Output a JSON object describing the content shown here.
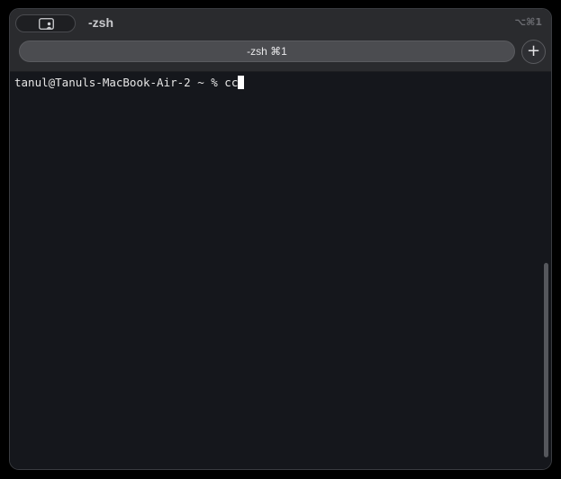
{
  "window": {
    "title": "-zsh",
    "shortcut_hint": "⌥⌘1"
  },
  "tabs": [
    {
      "label": "-zsh ⌘1",
      "active": true
    }
  ],
  "new_tab": {
    "label": "+"
  },
  "icons": {
    "sidebar_toggle": "sidebar-person-icon"
  },
  "terminal": {
    "prompt": "tanul@Tanuls-MacBook-Air-2 ~ % ",
    "input": "cc"
  },
  "colors": {
    "window_bg": "#15171c",
    "titlebar_bg": "#2a2b2e",
    "tab_bg": "#4b4c50",
    "text": "#e6e6e6",
    "cursor": "#ffffff"
  }
}
